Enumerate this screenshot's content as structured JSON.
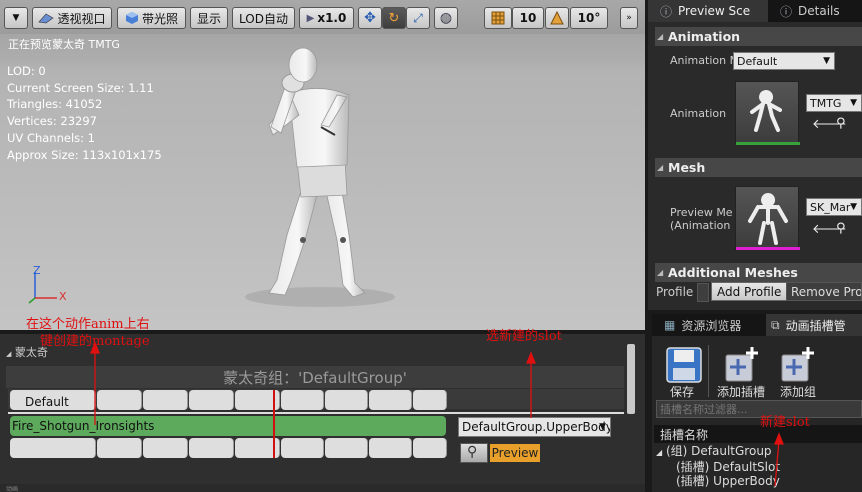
{
  "viewport": {
    "toolbar": {
      "perspective_label": "透视视口",
      "lit_label": "带光照",
      "show_label": "显示",
      "lod_label": "LOD自动",
      "speed_label": "x1.0",
      "grid_snap_value": "10",
      "rotate_snap_value": "10°"
    },
    "preview_label": "正在预览蒙太奇 TMTG",
    "stats": [
      "LOD: 0",
      "Current Screen Size: 1.11",
      "Triangles: 41052",
      "Vertices: 23297",
      "UV Channels: 1",
      "Approx Size: 113x101x175"
    ],
    "axis_x": "X",
    "axis_z": "Z"
  },
  "right_panel": {
    "tabs": [
      "Preview Sce",
      "Details"
    ],
    "animation_section": {
      "title": "Animation",
      "mode_label": "Animation M",
      "mode_value": "Default",
      "anim_label": "Animation",
      "anim_value": "TMTG"
    },
    "mesh_section": {
      "title": "Mesh",
      "preview_label_1": "Preview Me",
      "preview_label_2": "(Animation",
      "mesh_value": "SK_Mar"
    },
    "additional_meshes": {
      "title": "Additional Meshes",
      "profile_label": "Profile",
      "add_profile": "Add Profile",
      "remove_profile": "Remove Profi"
    }
  },
  "bottom_tabs": [
    "资源浏览器",
    "动画插槽管"
  ],
  "slot_manager": {
    "save": "保存",
    "add_slot": "添加插槽",
    "add_group": "添加组",
    "filter_placeholder": "插槽名称过滤器...",
    "header": "插槽名称",
    "tree": [
      "(组) DefaultGroup",
      "(插槽) DefaultSlot",
      "(插槽) UpperBody"
    ]
  },
  "montage": {
    "header": "蒙太奇",
    "group_title": "蒙太奇组：'DefaultGroup'",
    "section_label": "Default",
    "segment_label": "Fire_Shotgun_Ironsights",
    "slot_select": "DefaultGroup.UpperBody",
    "preview_btn": "Preview",
    "bottom_text": "动画"
  },
  "annotations": {
    "note1_line1": "在这个动作anim上右",
    "note1_line2": "键创建的montage",
    "note2": "选新建的slot",
    "note3": "新建slot"
  }
}
